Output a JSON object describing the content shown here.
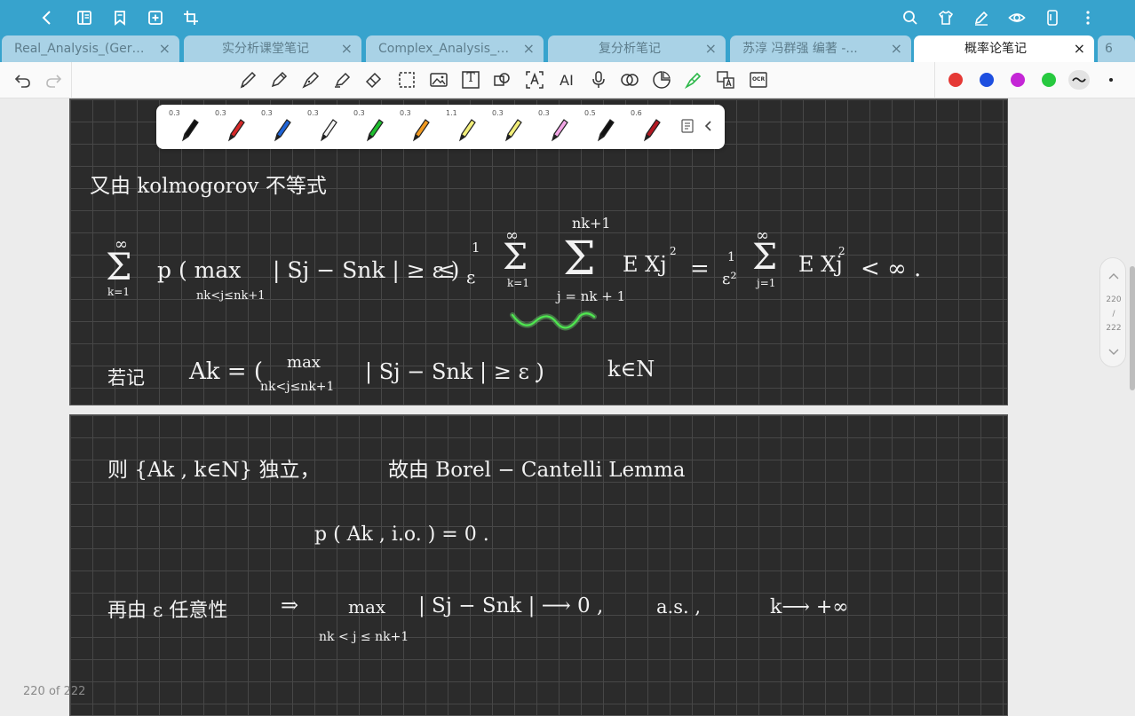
{
  "topbar": {
    "left_icons": [
      "back-icon",
      "outline-icon",
      "bookmark-icon",
      "add-page-icon",
      "crop-icon"
    ],
    "right_icons": [
      "search-icon",
      "shirt-icon",
      "pen-icon",
      "eye-icon",
      "phone-icon",
      "more-icon"
    ]
  },
  "tabs": [
    {
      "label": "Real_Analysis_(Gera...",
      "active": false
    },
    {
      "label": "实分析课堂笔记",
      "active": false
    },
    {
      "label": "Complex_Analysis_(...",
      "active": false
    },
    {
      "label": "复分析笔记",
      "active": false
    },
    {
      "label": "苏淳 冯群强 编著 -...",
      "active": false
    },
    {
      "label": "概率论笔记",
      "active": true
    },
    {
      "label": "6",
      "active": false
    }
  ],
  "tab_close_glyph": "×",
  "toolbar": {
    "tools": [
      "pen-tool-icon",
      "pencil-tool-icon",
      "fountain-pen-icon",
      "highlighter-icon",
      "eraser-icon",
      "lasso-icon",
      "image-icon",
      "text-box-icon",
      "shape-icon",
      "text-recognize-icon",
      "ai-icon",
      "microphone-icon",
      "link-icon",
      "sticker-icon",
      "laser-pointer-icon",
      "translate-icon",
      "ocr-icon"
    ],
    "tool_text": {
      "text_box": "T",
      "ai": "AI",
      "ocr": "OCR"
    },
    "colors": [
      "#e53935",
      "#1e4fe0",
      "#c426d6",
      "#27c93f"
    ],
    "accent": "#37a3cd"
  },
  "pen_tray": {
    "pens": [
      {
        "width": "0.3",
        "color": "#111111"
      },
      {
        "width": "0.3",
        "color": "#d62828"
      },
      {
        "width": "0.3",
        "color": "#1e63d6"
      },
      {
        "width": "0.3",
        "color": "#f5f5f5"
      },
      {
        "width": "0.3",
        "color": "#1fbf2f"
      },
      {
        "width": "0.3",
        "color": "#f29a20"
      },
      {
        "width": "1.1",
        "color": "#f3ef7a"
      },
      {
        "width": "0.3",
        "color": "#f3ef7a"
      },
      {
        "width": "0.3",
        "color": "#f2a6e6"
      },
      {
        "width": "0.5",
        "color": "#111111"
      },
      {
        "width": "0.6",
        "color": "#b31822"
      }
    ]
  },
  "handwriting": {
    "line1": "又由 kolmogorov 不等式",
    "sum_sub": "k=1",
    "sum_sup": "∞",
    "p_max": "p ( max",
    "max_sub": "nk<j≤nk+1",
    "abs_part": "| Sj − Snk | ≥ ε )",
    "leq": "≤",
    "frac1": "1",
    "eps": "ε",
    "big_sum": "Σ",
    "nk1": "nk+1",
    "j_eq": "j = nk + 1",
    "k_eq": "k=1",
    "j_eq1": "j=1",
    "exj": "E Xj",
    "sq": "2",
    "eq": "=",
    "eps2": "ε²",
    "lt_inf": "< ∞ .",
    "ak_def_prefix": "若记",
    "ak_def": "Ak = (",
    "ak_max": "max",
    "ak_abs": "| Sj − Snk | ≥ ε )",
    "dot": ".",
    "k_in_n": "k∈N",
    "line_then": "则 {Ak , k∈N} 独立，",
    "borel": "故由 Borel − Cantelli   Lemma",
    "p_ak": "p ( Ak , i.o. ) = 0 .",
    "again": "再由 ε 任意性",
    "implies": "⇒",
    "lim_max": "max",
    "lim_abs": "| Sj − Snk | ⟶ 0 ,",
    "as": "a.s. ,",
    "k_to_inf": "k⟶ +∞",
    "lim_sub": "nk < j ≤ nk+1"
  },
  "pager": {
    "current": "220",
    "sep": "/",
    "total": "222"
  },
  "page_counter": "220 of 222"
}
